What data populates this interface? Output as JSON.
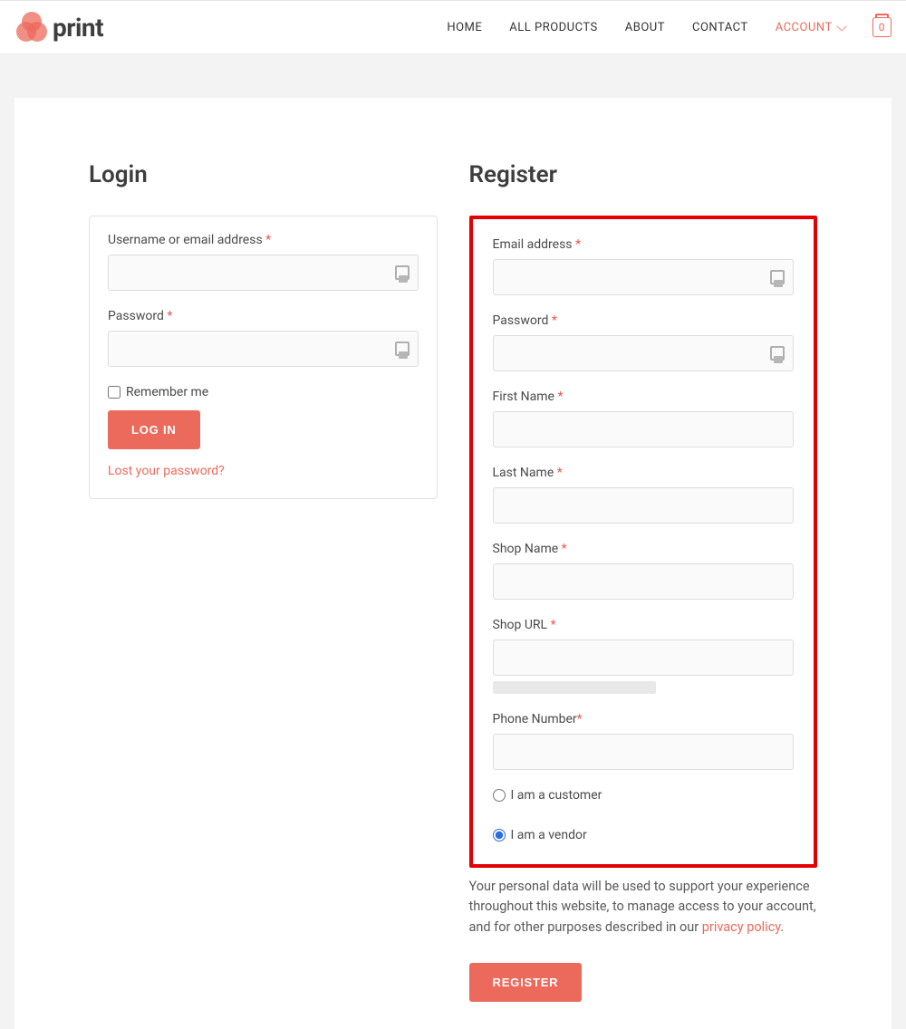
{
  "brand": {
    "name": "print"
  },
  "nav": {
    "home": "HOME",
    "products": "ALL PRODUCTS",
    "about": "ABOUT",
    "contact": "CONTACT",
    "account": "ACCOUNT",
    "cart_count": "0"
  },
  "login": {
    "heading": "Login",
    "username_label": "Username or email address ",
    "password_label": "Password ",
    "remember_label": "Remember me",
    "submit": "LOG IN",
    "lost_password": "Lost your password?"
  },
  "register": {
    "heading": "Register",
    "email_label": "Email address ",
    "password_label": "Password ",
    "first_name_label": "First Name ",
    "last_name_label": "Last Name ",
    "shop_name_label": "Shop Name ",
    "shop_url_label": "Shop URL ",
    "phone_label": "Phone Number",
    "role_customer": "I am a customer",
    "role_vendor": "I am a vendor",
    "privacy_text": "Your personal data will be used to support your experience throughout this website, to manage access to your account, and for other purposes described in our ",
    "privacy_link": "privacy policy",
    "privacy_tail": ".",
    "submit": "REGISTER"
  },
  "asterisk": "*"
}
